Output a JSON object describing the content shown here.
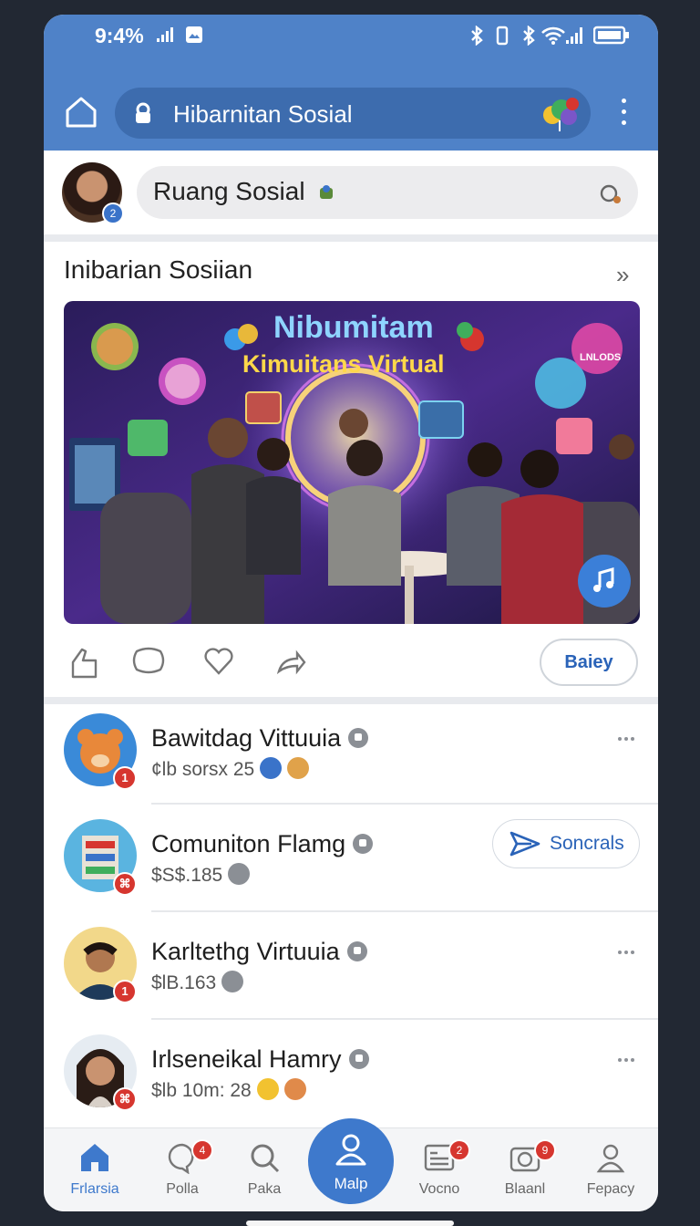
{
  "status_bar": {
    "time": "9:4%"
  },
  "app_bar": {
    "title": "Hibarnitan Sosial",
    "home_icon": "home-icon",
    "lock_icon": "lock-icon",
    "menu_icon": "more-vert-icon",
    "accent_color": "#4f82c8"
  },
  "composer": {
    "placeholder": "Ruang Sosial",
    "avatar_badge": "2"
  },
  "feed_section": {
    "title": "Inibarian Sosiian",
    "image_headline_1": "Nibumitam",
    "image_headline_2": "Kimuitans Virtual",
    "image_sign": "LNLODS",
    "actions": [
      "like-icon",
      "comment-icon",
      "heart-icon",
      "share-icon"
    ],
    "save_label": "Baiey"
  },
  "list": [
    {
      "name": "Bawitdag Vittuuia",
      "meta": "¢lb sorsx 25",
      "badge": "1",
      "action": "more"
    },
    {
      "name": "Comuniton Flamg",
      "meta": "$S$.185",
      "badge": "⌘",
      "action": "Soncrals"
    },
    {
      "name": "Karltethg Virtuuia",
      "meta": "$lB.163",
      "badge": "1",
      "action": "more"
    },
    {
      "name": "Irlseneikal Hamry",
      "meta": "$lb 10m: 28",
      "badge": "⌘",
      "action": "more"
    }
  ],
  "bottom_nav": [
    {
      "label": "Frlarsia",
      "icon": "home-icon",
      "badge": "",
      "active": true
    },
    {
      "label": "Polla",
      "icon": "chat-icon",
      "badge": "4",
      "active": false
    },
    {
      "label": "Paka",
      "icon": "search-icon",
      "badge": "",
      "active": false
    },
    {
      "label": "Malp",
      "icon": "profile-icon",
      "badge": "",
      "active": false
    },
    {
      "label": "Vocno",
      "icon": "news-icon",
      "badge": "2",
      "active": false
    },
    {
      "label": "Blaanl",
      "icon": "camera-icon",
      "badge": "9",
      "active": false
    },
    {
      "label": "Fepacy",
      "icon": "person-icon",
      "badge": "",
      "active": false
    }
  ]
}
